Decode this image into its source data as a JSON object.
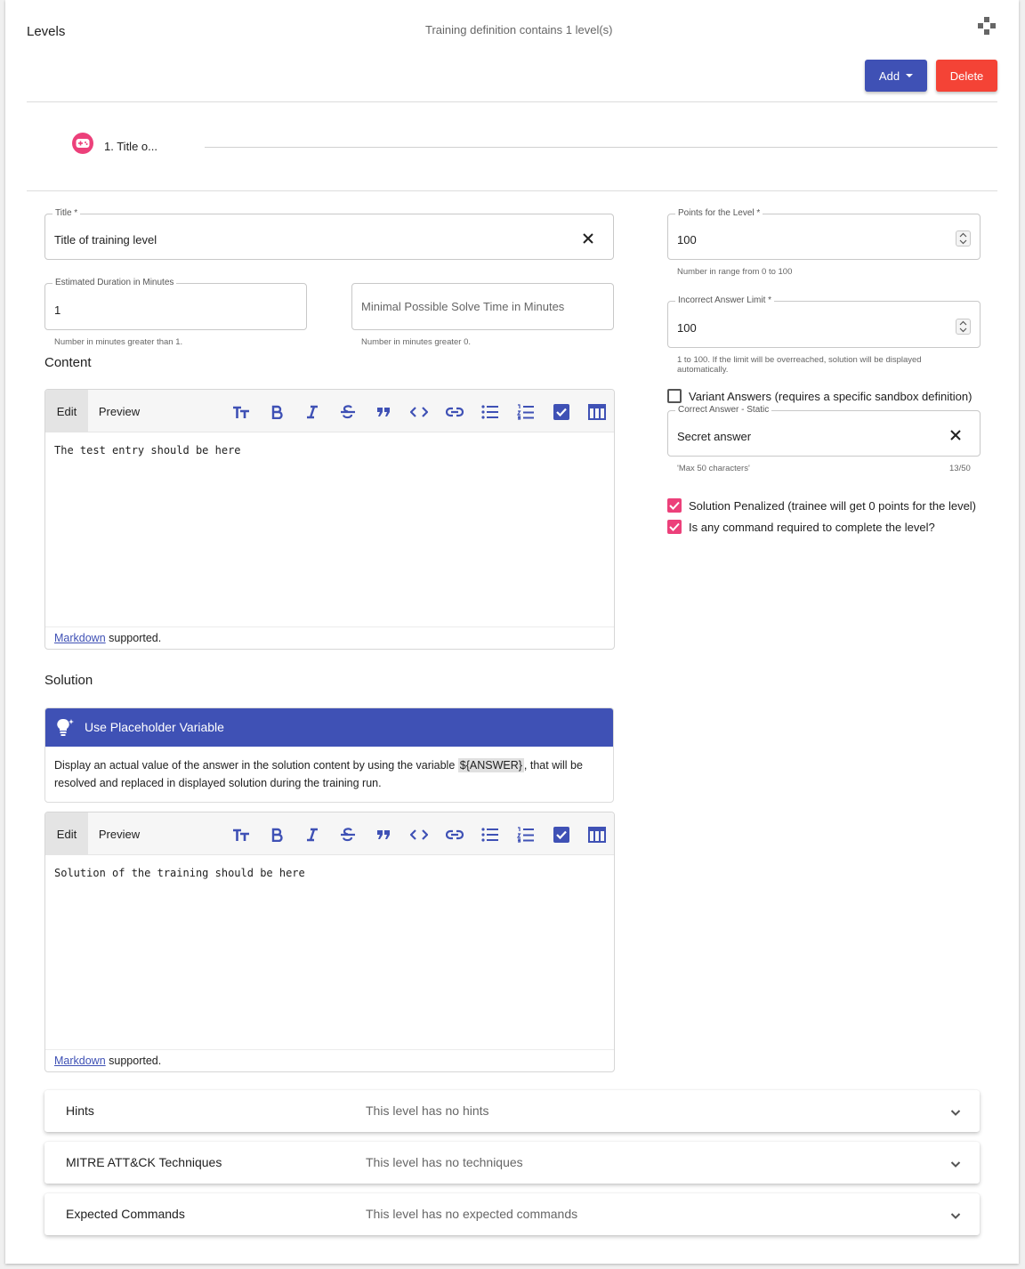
{
  "header": {
    "title": "Levels",
    "count_text": "Training definition contains 1 level(s)",
    "add_label": "Add",
    "delete_label": "Delete"
  },
  "stepper": {
    "step_label": "1. Title o..."
  },
  "form": {
    "title": {
      "label": "Title *",
      "value": "Title of training level"
    },
    "estimated_duration": {
      "label": "Estimated Duration in Minutes",
      "value": "1",
      "hint": "Number in minutes greater than 1."
    },
    "min_solve_time": {
      "placeholder": "Minimal Possible Solve Time in Minutes",
      "hint": "Number in minutes greater 0."
    },
    "points": {
      "label": "Points for the Level *",
      "value": "100",
      "hint": "Number in range from 0 to 100"
    },
    "incorrect_limit": {
      "label": "Incorrect Answer Limit *",
      "value": "100",
      "hint": "1 to 100. If the limit will be overreached, solution will be displayed automatically."
    },
    "variant_answers": {
      "label": "Variant Answers (requires a specific sandbox definition)",
      "checked": false
    },
    "correct_answer": {
      "label": "Correct Answer - Static",
      "value": "Secret answer",
      "hint": "'Max 50 characters'",
      "counter": "13/50"
    },
    "solution_penalized": {
      "label": "Solution Penalized (trainee will get 0 points for the level)",
      "checked": true
    },
    "command_required": {
      "label": "Is any command required to complete the level?",
      "checked": true
    }
  },
  "content": {
    "section_title": "Content",
    "tab_edit": "Edit",
    "tab_preview": "Preview",
    "text": "The test entry should be here",
    "footer_link": "Markdown",
    "footer_text": " supported."
  },
  "solution": {
    "section_title": "Solution",
    "info_title": "Use Placeholder Variable",
    "info_text_before": "Display an actual value of the answer in the solution content by using the variable ",
    "info_code": "${ANSWER}",
    "info_text_after": ", that will be resolved and replaced in displayed solution during the training run.",
    "tab_edit": "Edit",
    "tab_preview": "Preview",
    "text": "Solution of the training should be here",
    "footer_link": "Markdown",
    "footer_text": " supported."
  },
  "panels": [
    {
      "title": "Hints",
      "desc": "This level has no hints"
    },
    {
      "title": "MITRE ATT&CK Techniques",
      "desc": "This level has no techniques"
    },
    {
      "title": "Expected Commands",
      "desc": "This level has no expected commands"
    }
  ],
  "colors": {
    "primary": "#3f51b5",
    "warn": "#f44336",
    "accent": "#ec407a"
  },
  "icons": {
    "header": "puzzle-icon",
    "step": "gamepad-icon",
    "toolbar": [
      "text-size-icon",
      "bold-icon",
      "italic-icon",
      "strikethrough-icon",
      "quote-icon",
      "code-icon",
      "link-icon",
      "bullet-list-icon",
      "numbered-list-icon",
      "checkbox-icon",
      "table-icon"
    ],
    "info": "lightbulb-icon",
    "clear": "close-icon",
    "panel": "chevron-down-icon"
  }
}
